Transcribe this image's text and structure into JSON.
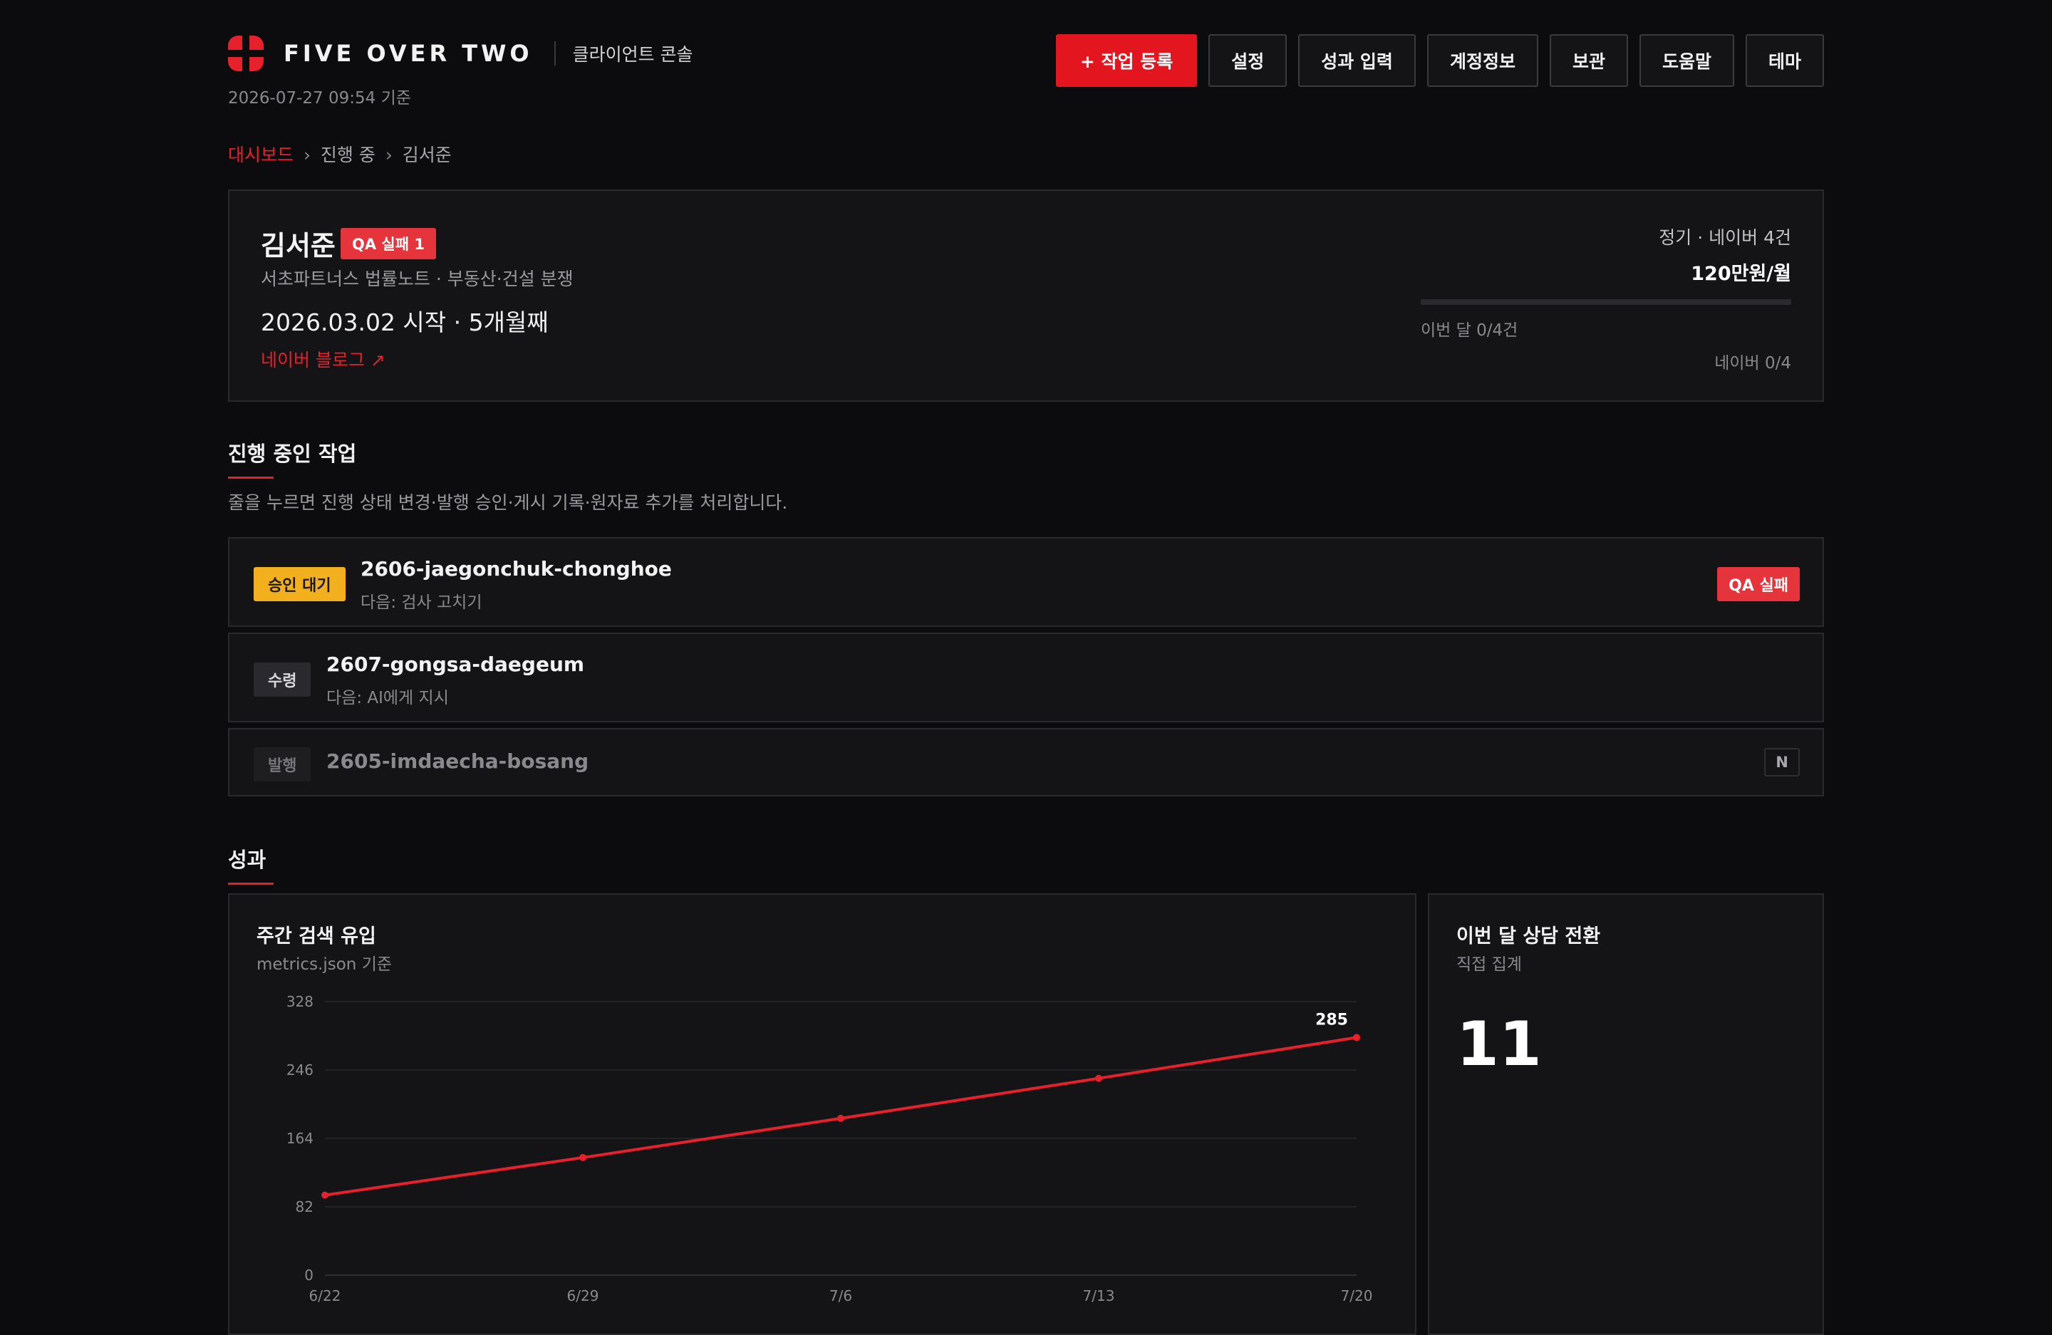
{
  "header": {
    "brand": "FIVE OVER TWO",
    "subtitle": "클라이언트 콘솔",
    "updated": "2026-07-27 09:54 기준",
    "nav": {
      "new_task": "+ 작업 등록",
      "settings": "설정",
      "perf_input": "성과 입력",
      "account": "계정정보",
      "archive": "보관",
      "help": "도움말",
      "theme": "테마"
    },
    "colors": {
      "accent": "#e6212b",
      "background": "#0c0c0e"
    }
  },
  "breadcrumb": {
    "home": "대시보드",
    "sep": "›",
    "section": "진행 중",
    "current": "김서준"
  },
  "client": {
    "name": "김서준",
    "qa_badge": "QA 실패 1",
    "desc": "서초파트너스 법률노트 · 부동산·건설 분쟁",
    "start": "2026.03.02 시작 · 5개월째",
    "link": "네이버 블로그 ↗",
    "plan": "정기 · 네이버 4건",
    "fee": "120만원/월",
    "month_progress": "이번 달 0/4건",
    "progress_fraction": 0,
    "naver_count": "네이버 0/4"
  },
  "tasks_section": {
    "title": "진행 중인 작업",
    "desc": "줄을 누르면 진행 상태 변경·발행 승인·게시 기록·원자료 추가를 처리합니다.",
    "items": [
      {
        "status": "승인 대기",
        "slug": "2606-jaegonchuk-chonghoe",
        "next": "다음: 검사 고치기",
        "badge": "QA 실패"
      },
      {
        "status": "수령",
        "slug": "2607-gongsa-daegeum",
        "next": "다음: AI에게 지시"
      },
      {
        "status": "발행",
        "slug": "2605-imdaecha-bosang",
        "badge": "N"
      }
    ]
  },
  "performance": {
    "title": "성과",
    "traffic": {
      "title": "주간 검색 유입",
      "sub": "metrics.json 기준"
    },
    "consult": {
      "title": "이번 달 상담 전환",
      "sub": "직접 집계",
      "value": "11"
    }
  },
  "chart_data": {
    "type": "line",
    "title": "주간 검색 유입",
    "x": [
      "6/22",
      "6/29",
      "7/6",
      "7/13",
      "7/20"
    ],
    "series": [
      {
        "values": [
          96,
          141,
          188,
          236,
          285
        ],
        "color": "#e6212b"
      }
    ],
    "yticks": [
      0,
      82,
      164,
      246,
      328
    ],
    "ylim": [
      0,
      328
    ],
    "data_labels": {
      "last": "285"
    },
    "grid": true
  }
}
